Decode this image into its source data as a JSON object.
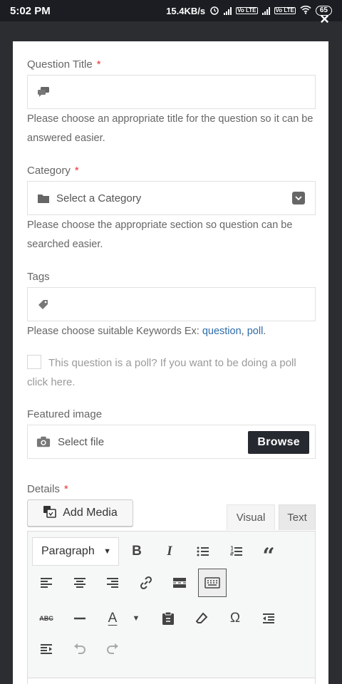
{
  "status_bar": {
    "time": "5:02 PM",
    "net_speed": "15.4KB/s",
    "volte_1": "Vo LTE",
    "volte_2": "Vo LTE",
    "battery": "65"
  },
  "close_label": "×",
  "form": {
    "question_title": {
      "label": "Question Title",
      "required_mark": "*",
      "help": "Please choose an appropriate title for the question so it can be answered easier."
    },
    "category": {
      "label": "Category",
      "required_mark": "*",
      "selected": "Select a Category",
      "help": "Please choose the appropriate section so question can be searched easier."
    },
    "tags": {
      "label": "Tags",
      "help_prefix": "Please choose suitable Keywords Ex: ",
      "example_1": "question",
      "separator": ", ",
      "example_2": "poll",
      "suffix": "."
    },
    "poll": {
      "label": "This question is a poll? If you want to be doing a poll click here."
    },
    "featured_image": {
      "label": "Featured image",
      "placeholder": "Select file",
      "browse_button": "Browse"
    },
    "details": {
      "label": "Details",
      "required_mark": "*",
      "add_media": "Add Media",
      "tab_visual": "Visual",
      "tab_text": "Text",
      "format_select": "Paragraph"
    }
  },
  "toolbar": {
    "bold": "B",
    "italic": "I",
    "blockquote": "“",
    "strike_abc": "ABC",
    "font_color": "A",
    "omega": "Ω"
  },
  "colors": {
    "accent_link": "#2f6ba8",
    "required": "#e33333",
    "browse_bg": "#26292f",
    "status_bar_bg": "#1b1d22"
  }
}
